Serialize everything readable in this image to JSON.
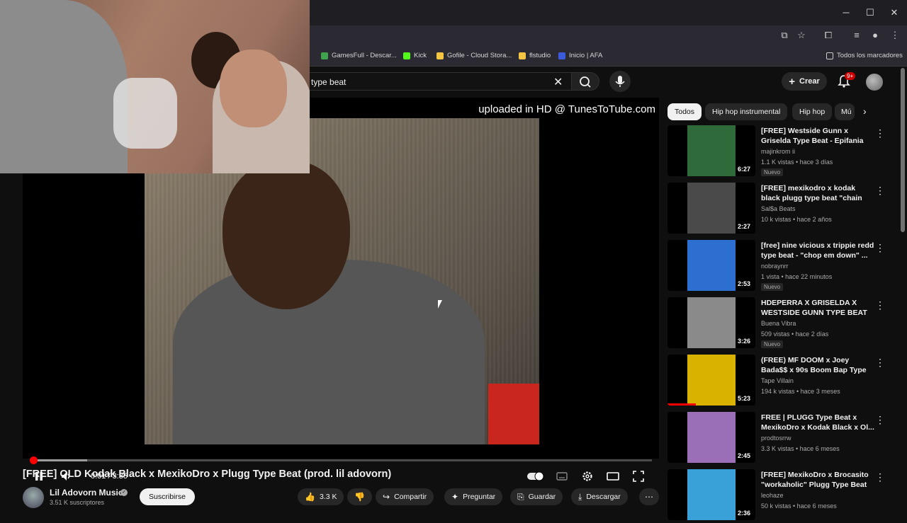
{
  "browser": {
    "bookmarks": [
      {
        "label": "GamesFull - Descar...",
        "color": "#3fa34d"
      },
      {
        "label": "Kick",
        "color": "#53fc18"
      },
      {
        "label": "Gofile - Cloud Stora...",
        "color": "#f4c542"
      },
      {
        "label": "flstudio",
        "color": "#f4c542"
      },
      {
        "label": "Inicio | AFA",
        "color": "#3b5bdb"
      }
    ],
    "all_bookmarks": "Todos los marcadores"
  },
  "masthead": {
    "search_value": "type beat",
    "create_label": "Crear",
    "notif_count": "9+"
  },
  "player": {
    "watermark": "uploaded in HD @ TunesToTube.com",
    "time": "0:01 / 3:35",
    "progress_fraction": 0.003,
    "buffer_fraction": 0.09
  },
  "video": {
    "title": "[FREE] OLD Kodak Black x MexikoDro x Plugg Type Beat (prod. lil adovorn)",
    "channel": "Lil Adovorn Music",
    "subscribers": "3.51 K suscriptores",
    "subscribe_label": "Suscribirse",
    "likes": "3.3 K",
    "share_label": "Compartir",
    "ask_label": "Preguntar",
    "save_label": "Guardar",
    "download_label": "Descargar"
  },
  "chips": [
    {
      "label": "Todos",
      "active": true
    },
    {
      "label": "Hip hop instrumental",
      "active": false
    },
    {
      "label": "Hip hop",
      "active": false
    },
    {
      "label": "Mú",
      "active": false
    }
  ],
  "recommendations": [
    {
      "title": "[FREE] Westside Gunn x Griselda Type Beat - Epifania",
      "channel": "majinkrom ii",
      "meta": "1.1 K vistas • hace 3 días",
      "badge": "Nuevo",
      "duration": "6:27",
      "art": "#2f6b3a"
    },
    {
      "title": "[FREE] mexikodro x kodak black plugg type beat \"chain bussin\"",
      "channel": "Sal$a Beats",
      "meta": "10 k vistas • hace 2 años",
      "badge": "",
      "duration": "2:27",
      "art": "#4a4a4a"
    },
    {
      "title": "[free] nine vicious x trippie redd type beat - \"chop em down\" ...",
      "channel": "nobraynrr",
      "meta": "1 vista • hace 22 minutos",
      "badge": "Nuevo",
      "duration": "2:53",
      "art": "#2c6fd0"
    },
    {
      "title": "HDEPERRA X GRISELDA X WESTSIDE GUNN TYPE BEAT |...",
      "channel": "Buena Vibra",
      "meta": "509 vistas • hace 2 días",
      "badge": "Nuevo",
      "duration": "3:26",
      "art": "#8a8a8a"
    },
    {
      "title": "(FREE) MF DOOM x Joey Bada$$ x 90s Boom Bap Type ...",
      "channel": "Tape Villain",
      "meta": "194 k vistas • hace 3 meses",
      "badge": "",
      "duration": "5:23",
      "art": "#d9b200"
    },
    {
      "title": "FREE | PLUGG Type Beat x MexikoDro x Kodak Black x Ol...",
      "channel": "prodtosrrw",
      "meta": "3.3 K vistas • hace 6 meses",
      "badge": "",
      "duration": "2:45",
      "art": "#9b6fb8"
    },
    {
      "title": "[FREE] MexikoDro x Brocasito \"workaholic\" Plugg Type Beat ...",
      "channel": "leohaze",
      "meta": "50 k vistas • hace 6 meses",
      "badge": "",
      "duration": "2:36",
      "art": "#3aa0d8"
    }
  ]
}
